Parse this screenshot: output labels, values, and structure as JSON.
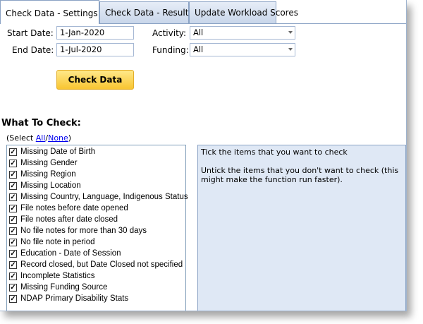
{
  "tabs": [
    {
      "label": "Check Data - Settings"
    },
    {
      "label": "Check Data - Results"
    },
    {
      "label": "Update Workload Scores"
    }
  ],
  "form": {
    "start_date_label": "Start Date:",
    "start_date_value": "1-Jan-2020",
    "end_date_label": "End Date:",
    "end_date_value": "1-Jul-2020",
    "activity_label": "Activity:",
    "activity_value": "All",
    "funding_label": "Funding:",
    "funding_value": "All"
  },
  "check_button_label": "Check Data",
  "what_to_check": {
    "heading": "What To Check:",
    "select_prefix": "(Select ",
    "all_link": "All",
    "separator": "/",
    "none_link": "None",
    "select_suffix": ")"
  },
  "check_items": [
    {
      "label": "Missing Date of Birth",
      "checked": true
    },
    {
      "label": "Missing Gender",
      "checked": true
    },
    {
      "label": "Missing Region",
      "checked": true
    },
    {
      "label": "Missing Location",
      "checked": true
    },
    {
      "label": "Missing Country, Language, Indigenous Status",
      "checked": true
    },
    {
      "label": "File notes before date opened",
      "checked": true
    },
    {
      "label": "File notes after date closed",
      "checked": true
    },
    {
      "label": "No file notes for more than 30 days",
      "checked": true
    },
    {
      "label": "No file note in period",
      "checked": true
    },
    {
      "label": "Education - Date of Session",
      "checked": true
    },
    {
      "label": "Record closed, but Date Closed not specified",
      "checked": true
    },
    {
      "label": "Incomplete Statistics",
      "checked": true
    },
    {
      "label": "Missing Funding Source",
      "checked": true
    },
    {
      "label": "NDAP Primary Disability Stats",
      "checked": true
    }
  ],
  "help": {
    "line1": "Tick the items that you want to check",
    "line2": "Untick the items that you don't want to check (this might make the function run faster)."
  }
}
